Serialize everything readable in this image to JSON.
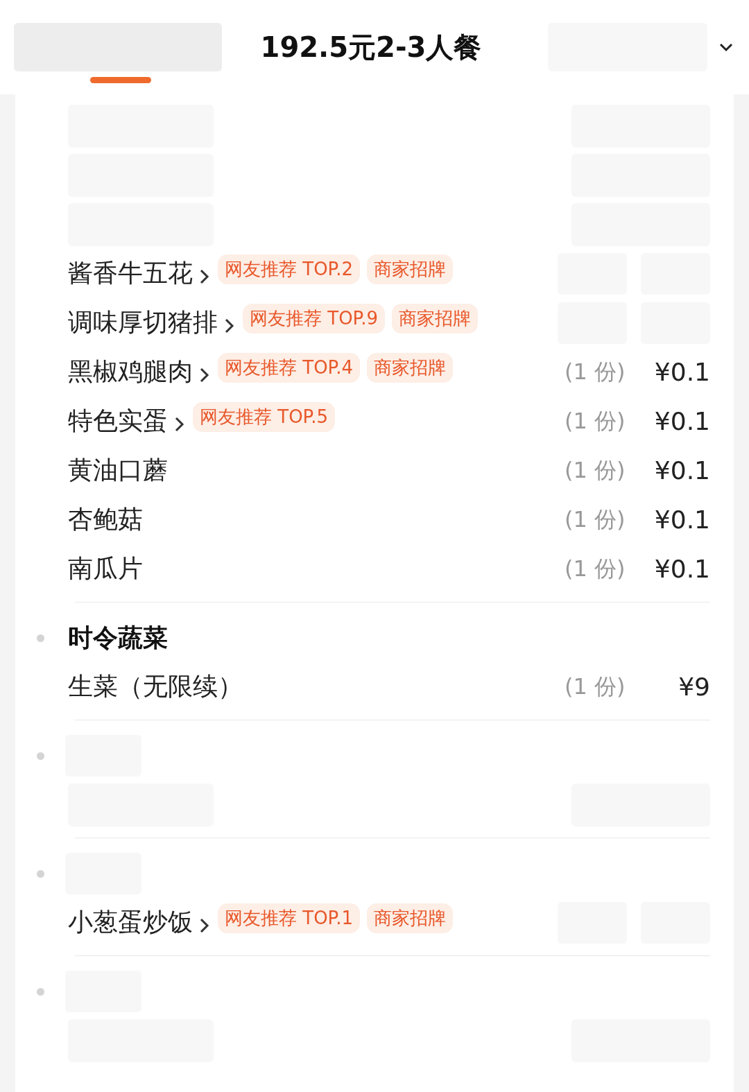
{
  "tabs": [
    {
      "selected": true
    },
    {
      "label": "192.5元2-3人餐",
      "selected": false
    }
  ],
  "sections": [
    {
      "items": [
        {
          "kind": "blurred"
        },
        {
          "kind": "blurred"
        },
        {
          "kind": "blurred"
        },
        {
          "kind": "dish",
          "name": "酱香牛五花",
          "has_detail": true,
          "tags": [
            "网友推荐 TOP.2",
            "商家招牌"
          ]
        },
        {
          "kind": "dish",
          "name": "调味厚切猪排",
          "has_detail": true,
          "tags": [
            "网友推荐 TOP.9",
            "商家招牌"
          ]
        },
        {
          "kind": "dish",
          "name": "黑椒鸡腿肉",
          "has_detail": true,
          "tags": [
            "网友推荐 TOP.4",
            "商家招牌"
          ],
          "quantity": "(1 份)",
          "price": "¥0.1"
        },
        {
          "kind": "dish",
          "name": "特色实蛋",
          "has_detail": true,
          "tags": [
            "网友推荐 TOP.5"
          ],
          "quantity": "(1 份)",
          "price": "¥0.1"
        },
        {
          "kind": "dish",
          "name": "黄油口蘑",
          "has_detail": false,
          "quantity": "(1 份)",
          "price": "¥0.1"
        },
        {
          "kind": "dish",
          "name": "杏鲍菇",
          "has_detail": false,
          "quantity": "(1 份)",
          "price": "¥0.1"
        },
        {
          "kind": "dish",
          "name": "南瓜片",
          "has_detail": false,
          "quantity": "(1 份)",
          "price": "¥0.1"
        }
      ]
    },
    {
      "heading": "时令蔬菜",
      "items": [
        {
          "kind": "dish",
          "name": "生菜（无限续）",
          "has_detail": false,
          "quantity": "(1 份)",
          "price": "¥9"
        }
      ]
    },
    {
      "items": [
        {
          "kind": "blurred"
        }
      ]
    },
    {
      "items": [
        {
          "kind": "dish",
          "name": "小葱蛋炒饭",
          "has_detail": true,
          "tags": [
            "网友推荐 TOP.1",
            "商家招牌"
          ]
        }
      ]
    },
    {
      "items": [
        {
          "kind": "blurred"
        }
      ]
    }
  ]
}
